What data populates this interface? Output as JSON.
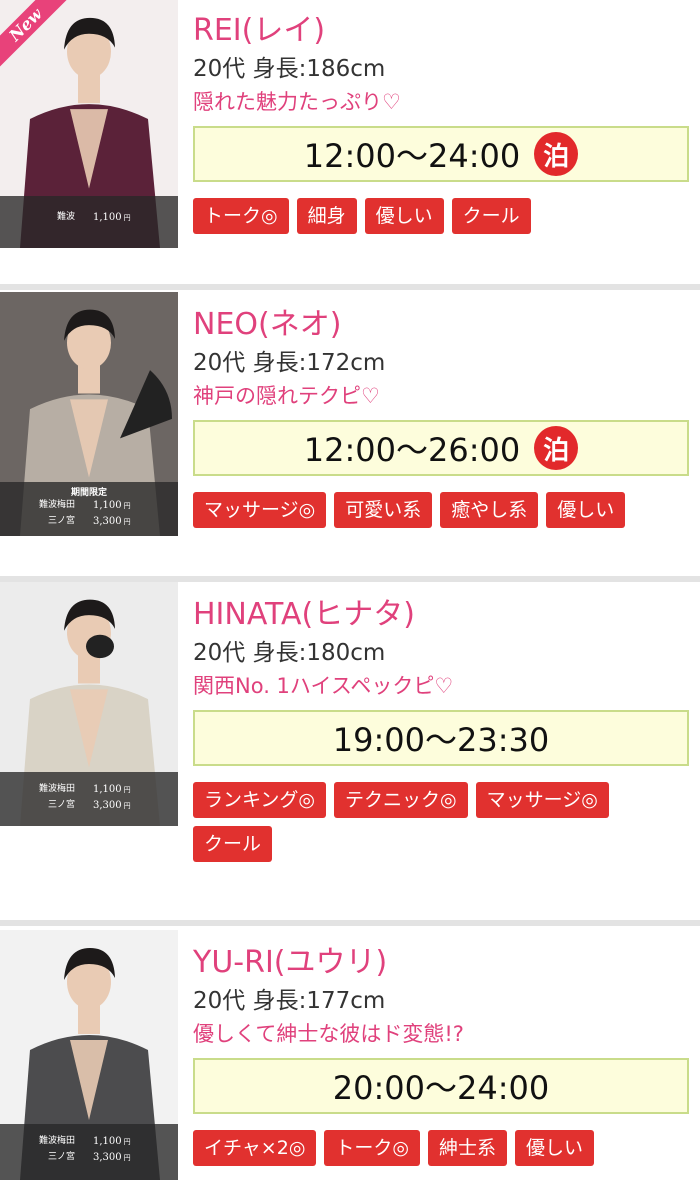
{
  "cast": [
    {
      "name": "REI(レイ)",
      "age": "20代",
      "height": "身長:186cm",
      "catchphrase": "隠れた魅力たっぷり♡",
      "hours": "12:00〜24:00",
      "stay_badge": "泊",
      "new_badge": "New",
      "price_label": "",
      "prices": [
        {
          "area": "難波",
          "amount": "1,100",
          "unit": "円"
        }
      ],
      "tags": [
        "トーク◎",
        "細身",
        "優しい",
        "クール"
      ],
      "photo_bg": "#f3eeee",
      "outfit_color": "#5b2239"
    },
    {
      "name": "NEO(ネオ)",
      "age": "20代",
      "height": "身長:172cm",
      "catchphrase": "神戸の隠れテクピ♡",
      "hours": "12:00〜26:00",
      "stay_badge": "泊",
      "new_badge": "",
      "price_label": "期間限定",
      "prices": [
        {
          "area": "難波梅田",
          "amount": "1,100",
          "unit": "円"
        },
        {
          "area": "三ノ宮",
          "amount": "3,300",
          "unit": "円"
        }
      ],
      "tags": [
        "マッサージ◎",
        "可愛い系",
        "癒やし系",
        "優しい"
      ],
      "photo_bg": "#6c6663",
      "outfit_color": "#b7aea4"
    },
    {
      "name": "HINATA(ヒナタ)",
      "age": "20代",
      "height": "身長:180cm",
      "catchphrase": "関西No. 1ハイスペックピ♡",
      "hours": "19:00〜23:30",
      "stay_badge": "",
      "new_badge": "",
      "price_label": "",
      "prices": [
        {
          "area": "難波梅田",
          "amount": "1,100",
          "unit": "円"
        },
        {
          "area": "三ノ宮",
          "amount": "3,300",
          "unit": "円"
        }
      ],
      "tags": [
        "ランキング◎",
        "テクニック◎",
        "マッサージ◎",
        "クール"
      ],
      "photo_bg": "#ececec",
      "outfit_color": "#d9d3c6"
    },
    {
      "name": "YU-RI(ユウリ)",
      "age": "20代",
      "height": "身長:177cm",
      "catchphrase": "優しくて紳士な彼はド変態!?",
      "hours": "20:00〜24:00",
      "stay_badge": "",
      "new_badge": "",
      "price_label": "",
      "prices": [
        {
          "area": "難波梅田",
          "amount": "1,100",
          "unit": "円"
        },
        {
          "area": "三ノ宮",
          "amount": "3,300",
          "unit": "円"
        }
      ],
      "tags": [
        "イチャ×2◎",
        "トーク◎",
        "紳士系",
        "優しい"
      ],
      "photo_bg": "#f2f2f2",
      "outfit_color": "#4c4c4e"
    }
  ],
  "colors": {
    "name_pink": "#e0417c",
    "tag_red": "#e1312f",
    "time_bg": "#fdfddc",
    "time_border": "#c9dc8a"
  }
}
